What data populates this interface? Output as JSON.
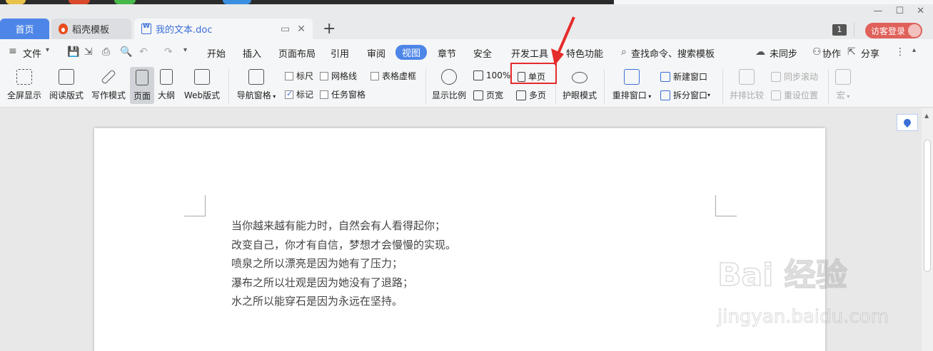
{
  "tabs": {
    "home": "首页",
    "template": "稻壳模板",
    "doc": "我的文本.doc",
    "add": "+"
  },
  "window": {
    "badge": "1",
    "login": "访客登录",
    "minimize": "—",
    "maximize": "☐",
    "close": "✕"
  },
  "menu": {
    "file": "文件",
    "items": [
      "开始",
      "插入",
      "页面布局",
      "引用",
      "审阅",
      "视图",
      "章节",
      "安全",
      "开发工具",
      "特色功能"
    ],
    "search": "查找命令、搜索模板",
    "sync": "未同步",
    "collab": "协作",
    "share": "分享"
  },
  "ribbon": {
    "fullscreen": "全屏显示",
    "reading": "阅读版式",
    "writing": "写作模式",
    "page": "页面",
    "outline": "大纲",
    "web": "Web版式",
    "nav_pane": "导航窗格",
    "ruler": "标尺",
    "gridlines": "网格线",
    "table_gridlines": "表格虚框",
    "marks": "标记",
    "task_pane": "任务窗格",
    "zoom": "显示比例",
    "zoom_100": "100%",
    "page_width": "页宽",
    "single_page": "单页",
    "multi_page": "多页",
    "eye_mode": "护眼模式",
    "rearrange": "重排窗口",
    "new_window": "新建窗口",
    "split_window": "拆分窗口",
    "side_by_side": "并排比较",
    "sync_scroll": "同步滚动",
    "reset_position": "重设位置",
    "macro": "宏"
  },
  "checks": {
    "ruler": false,
    "gridlines": false,
    "table_gridlines": false,
    "marks": true,
    "task_pane": false
  },
  "document": {
    "lines": [
      "当你越来越有能力时，自然会有人看得起你；",
      "改变自己，你才有自信，梦想才会慢慢的实现。",
      "喷泉之所以漂亮是因为她有了压力；",
      "瀑布之所以壮观是因为她没有了退路；",
      "水之所以能穿石是因为永远在坚持。"
    ]
  },
  "watermark": {
    "main": "Bai 经验",
    "sub": "jingyan.baidu.com"
  },
  "colors": {
    "accent": "#4e86e8",
    "highlight": "#e62b2b",
    "login": "#e0605a"
  }
}
